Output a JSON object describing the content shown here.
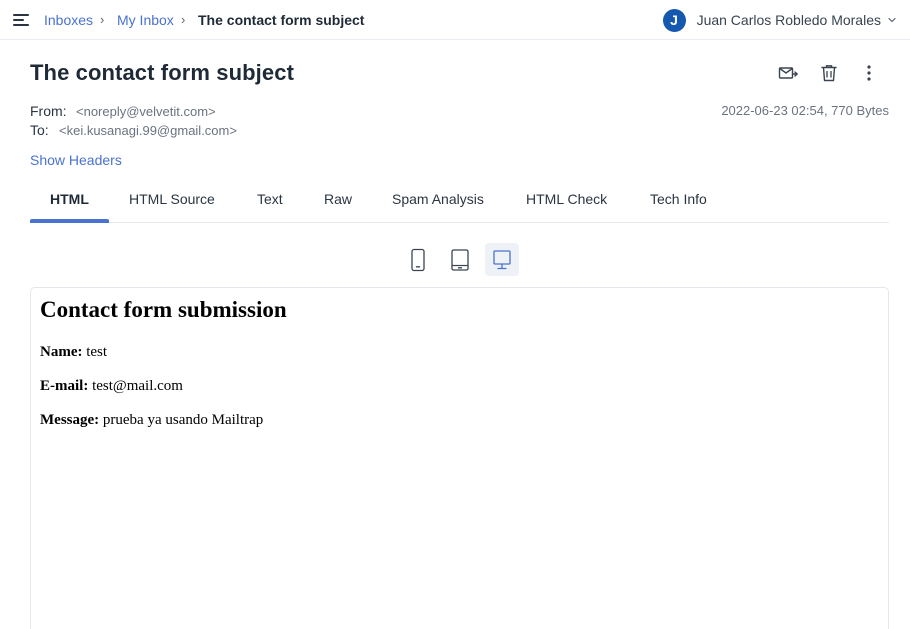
{
  "breadcrumb": {
    "items": [
      "Inboxes",
      "My Inbox"
    ],
    "separator": "›",
    "current": "The contact form subject"
  },
  "user": {
    "initial": "J",
    "name": "Juan Carlos Robledo Morales",
    "avatar_color": "#1558b0"
  },
  "message": {
    "subject": "The contact form subject",
    "from_label": "From:",
    "from_value": "<noreply@velvetit.com>",
    "to_label": "To:",
    "to_value": "<kei.kusanagi.99@gmail.com>",
    "date_size": "2022-06-23 02:54, 770 Bytes",
    "show_headers": "Show Headers"
  },
  "actions": {
    "icons": [
      "forward-icon",
      "trash-icon",
      "more-vertical-icon"
    ]
  },
  "tabs": [
    {
      "label": "HTML",
      "active": true
    },
    {
      "label": "HTML Source",
      "active": false
    },
    {
      "label": "Text",
      "active": false
    },
    {
      "label": "Raw",
      "active": false
    },
    {
      "label": "Spam Analysis",
      "active": false
    },
    {
      "label": "HTML Check",
      "active": false
    },
    {
      "label": "Tech Info",
      "active": false
    }
  ],
  "device_switcher": {
    "icons": [
      "mobile-icon",
      "tablet-icon",
      "desktop-icon"
    ],
    "active": "desktop-icon"
  },
  "preview": {
    "heading": "Contact form submission",
    "fields": [
      {
        "label": "Name:",
        "value": "test"
      },
      {
        "label": "E-mail:",
        "value": "test@mail.com"
      },
      {
        "label": "Message:",
        "value": "prueba ya usando Mailtrap"
      }
    ]
  },
  "colors": {
    "accent": "#4a72d0",
    "text": "#1f2a37",
    "muted": "#6b7380"
  }
}
